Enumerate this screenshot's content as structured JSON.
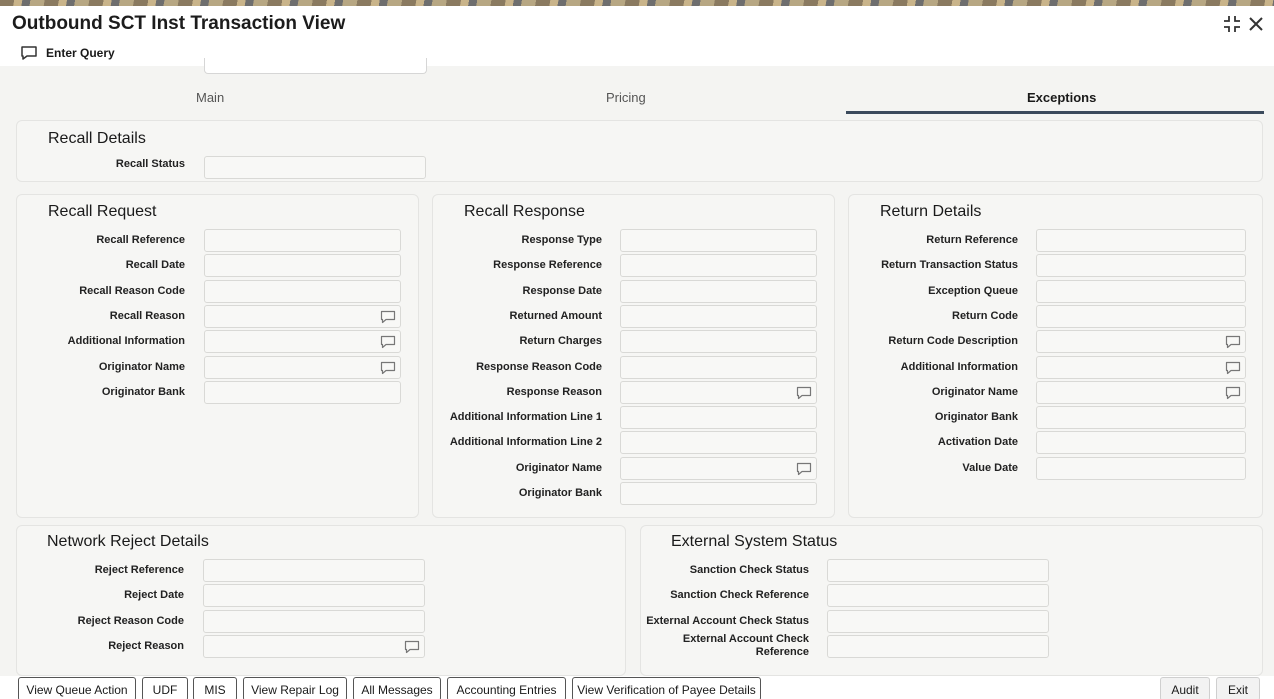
{
  "window": {
    "title": "Outbound SCT Inst Transaction View"
  },
  "toolbar": {
    "enter_query": "Enter Query"
  },
  "tabs": [
    {
      "label": "Main"
    },
    {
      "label": "Pricing"
    },
    {
      "label": "Exceptions",
      "active": true
    }
  ],
  "recall_details": {
    "title": "Recall Details",
    "fields": [
      {
        "label": "Recall Status",
        "value": ""
      }
    ]
  },
  "recall_request": {
    "title": "Recall Request",
    "fields": [
      {
        "label": "Recall Reference",
        "value": ""
      },
      {
        "label": "Recall Date",
        "value": ""
      },
      {
        "label": "Recall Reason Code",
        "value": ""
      },
      {
        "label": "Recall Reason",
        "value": "",
        "icon": "comment-icon"
      },
      {
        "label": "Additional Information",
        "value": "",
        "icon": "comment-icon"
      },
      {
        "label": "Originator Name",
        "value": "",
        "icon": "comment-icon"
      },
      {
        "label": "Originator Bank",
        "value": ""
      }
    ]
  },
  "recall_response": {
    "title": "Recall Response",
    "fields": [
      {
        "label": "Response Type",
        "value": ""
      },
      {
        "label": "Response Reference",
        "value": ""
      },
      {
        "label": "Response Date",
        "value": ""
      },
      {
        "label": "Returned Amount",
        "value": ""
      },
      {
        "label": "Return Charges",
        "value": ""
      },
      {
        "label": "Response Reason Code",
        "value": ""
      },
      {
        "label": "Response Reason",
        "value": "",
        "icon": "comment-icon"
      },
      {
        "label": "Additional Information Line 1",
        "value": ""
      },
      {
        "label": "Additional Information Line 2",
        "value": ""
      },
      {
        "label": "Originator Name",
        "value": "",
        "icon": "comment-icon"
      },
      {
        "label": "Originator Bank",
        "value": ""
      }
    ]
  },
  "return_details": {
    "title": "Return Details",
    "fields": [
      {
        "label": "Return Reference",
        "value": ""
      },
      {
        "label": "Return Transaction Status",
        "value": ""
      },
      {
        "label": "Exception Queue",
        "value": ""
      },
      {
        "label": "Return Code",
        "value": ""
      },
      {
        "label": "Return Code Description",
        "value": "",
        "icon": "comment-icon"
      },
      {
        "label": "Additional Information",
        "value": "",
        "icon": "comment-icon"
      },
      {
        "label": "Originator Name",
        "value": "",
        "icon": "comment-icon"
      },
      {
        "label": "Originator Bank",
        "value": ""
      },
      {
        "label": "Activation Date",
        "value": ""
      },
      {
        "label": "Value Date",
        "value": ""
      }
    ]
  },
  "network_reject": {
    "title": "Network Reject Details",
    "fields": [
      {
        "label": "Reject Reference",
        "value": ""
      },
      {
        "label": "Reject Date",
        "value": ""
      },
      {
        "label": "Reject Reason Code",
        "value": ""
      },
      {
        "label": "Reject Reason",
        "value": "",
        "icon": "comment-icon"
      }
    ]
  },
  "external_status": {
    "title": "External System Status",
    "fields": [
      {
        "label": "Sanction Check Status",
        "value": ""
      },
      {
        "label": "Sanction Check Reference",
        "value": ""
      },
      {
        "label": "External Account Check Status",
        "value": ""
      },
      {
        "label": "External Account Check Reference",
        "value": ""
      }
    ]
  },
  "footer": {
    "buttons": [
      "View Queue Action",
      "UDF",
      "MIS",
      "View Repair Log",
      "All Messages",
      "Accounting Entries",
      "View Verification of Payee Details"
    ],
    "audit": "Audit",
    "exit": "Exit"
  }
}
